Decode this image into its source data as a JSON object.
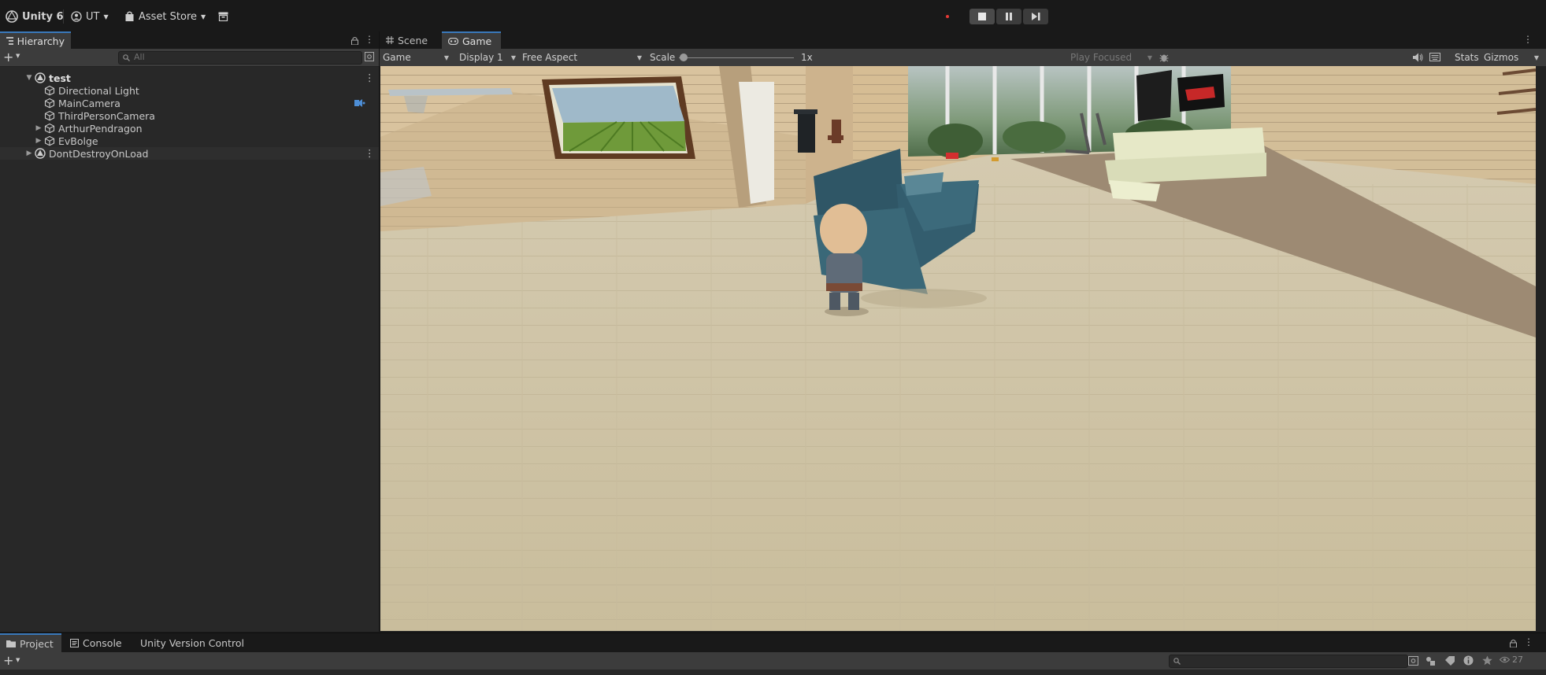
{
  "toolbar": {
    "product": "Unity 6",
    "account": "UT",
    "asset_store": "Asset Store"
  },
  "hierarchy": {
    "tab": "Hierarchy",
    "search_placeholder": "All",
    "root": "test",
    "items": [
      {
        "label": "Directional Light",
        "expandable": false
      },
      {
        "label": "MainCamera",
        "expandable": false
      },
      {
        "label": "ThirdPersonCamera",
        "expandable": false
      },
      {
        "label": "ArthurPendragon",
        "expandable": true
      },
      {
        "label": "EvBolge",
        "expandable": true
      }
    ],
    "dont_destroy": "DontDestroyOnLoad"
  },
  "game_view": {
    "tabs": [
      "Scene",
      "Game"
    ],
    "active_tab": "Game",
    "mode": "Game",
    "display": "Display 1",
    "aspect": "Free Aspect",
    "scale_label": "Scale",
    "scale_value": "1x",
    "scale_level": 0,
    "play_focused": "Play Focused",
    "stats": "Stats",
    "gizmos": "Gizmos"
  },
  "bottom": {
    "tabs": [
      "Project",
      "Console",
      "Unity Version Control"
    ],
    "active_tab": "Project",
    "count": "27"
  },
  "colors": {
    "accent": "#3a79bb",
    "play_indicator": "#e53935"
  }
}
